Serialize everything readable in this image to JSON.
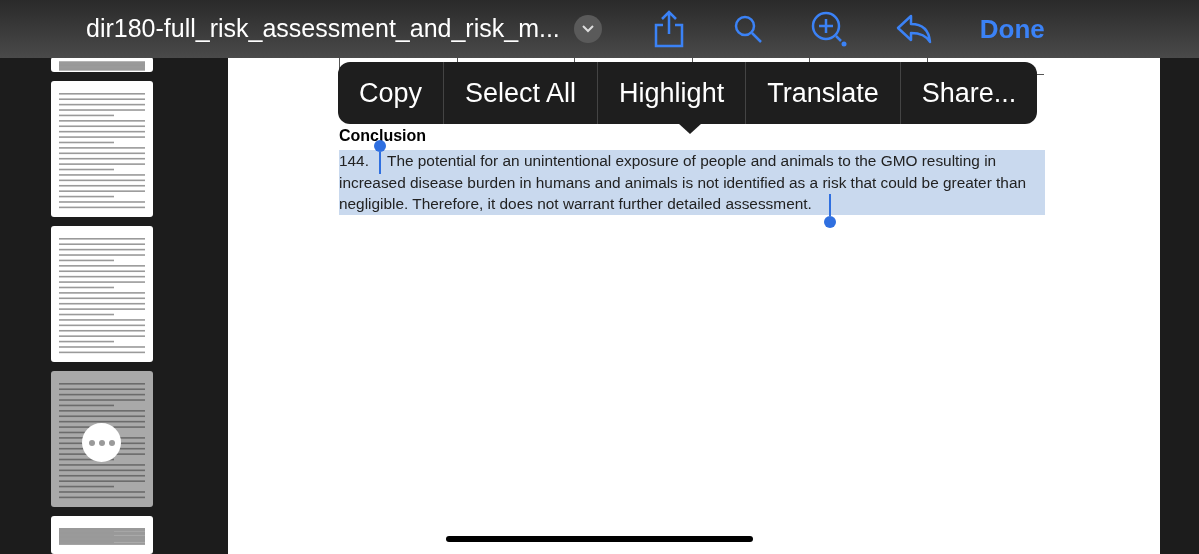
{
  "toolbar": {
    "title": "dir180-full_risk_assessment_and_risk_m...",
    "done": "Done"
  },
  "thumbnails": [
    {
      "selected": false
    },
    {
      "selected": false
    },
    {
      "selected": false
    },
    {
      "selected": true
    },
    {
      "selected": false
    }
  ],
  "context_menu": [
    "Copy",
    "Select All",
    "Highlight",
    "Translate",
    "Share..."
  ],
  "document": {
    "heading": "Conclusion",
    "number": "144.",
    "paragraph": "The potential for an unintentional exposure of people and animals to the GMO resulting in increased disease burden in humans and animals is not identified as a risk that could be greater than negligible. Therefore, it does not warrant further detailed assessment.",
    "selected": true
  }
}
